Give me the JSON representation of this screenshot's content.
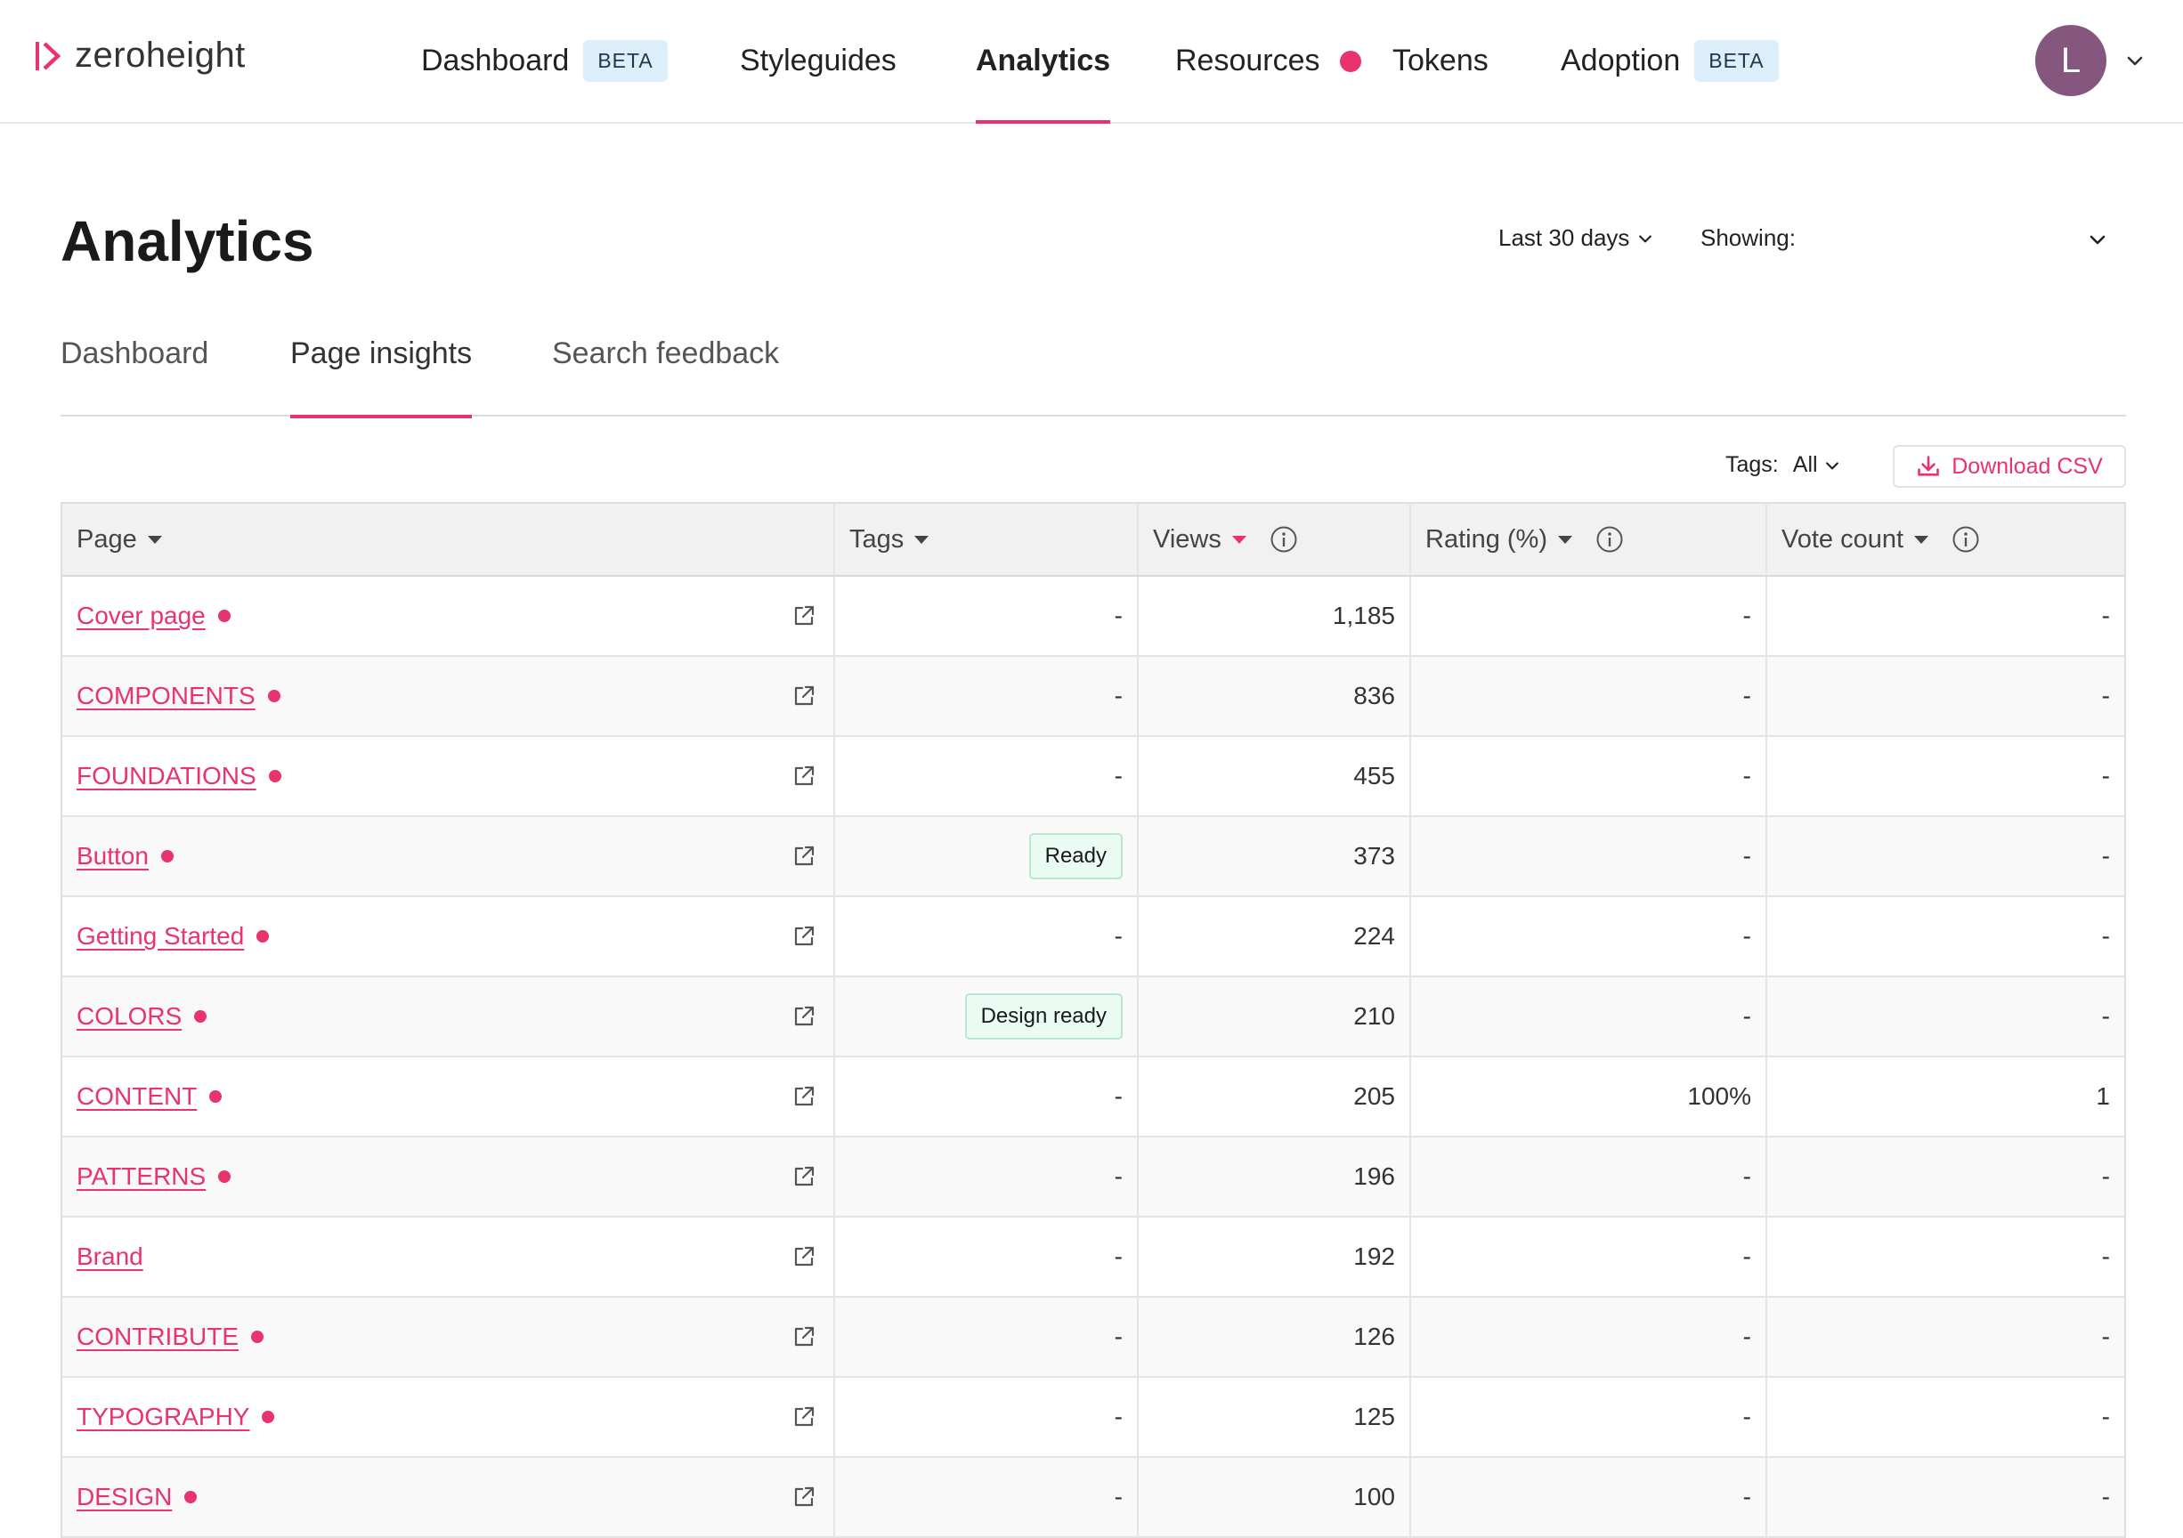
{
  "brand": {
    "name": "zeroheight",
    "accent": "#e8336d"
  },
  "nav": {
    "items": [
      {
        "label": "Dashboard",
        "badge": "BETA"
      },
      {
        "label": "Styleguides"
      },
      {
        "label": "Analytics"
      },
      {
        "label": "Resources"
      },
      {
        "label": "Tokens"
      },
      {
        "label": "Adoption",
        "badge": "BETA"
      }
    ],
    "active": "Analytics"
  },
  "user": {
    "initial": "L"
  },
  "header": {
    "title": "Analytics",
    "range_label": "Last 30 days",
    "showing_label": "Showing:"
  },
  "subtabs": [
    {
      "label": "Dashboard"
    },
    {
      "label": "Page insights"
    },
    {
      "label": "Search feedback"
    }
  ],
  "toolbar": {
    "tags_label": "Tags:",
    "tags_value": "All",
    "download_label": "Download CSV"
  },
  "table": {
    "columns": {
      "page": "Page",
      "tags": "Tags",
      "views": "Views",
      "rating": "Rating (%)",
      "votes": "Vote count"
    },
    "rows": [
      {
        "page": "Cover page",
        "dot": true,
        "tags": "-",
        "tag_pill": false,
        "views": "1,185",
        "rating": "-",
        "votes": "-"
      },
      {
        "page": "COMPONENTS",
        "dot": true,
        "tags": "-",
        "tag_pill": false,
        "views": "836",
        "rating": "-",
        "votes": "-"
      },
      {
        "page": "FOUNDATIONS",
        "dot": true,
        "tags": "-",
        "tag_pill": false,
        "views": "455",
        "rating": "-",
        "votes": "-"
      },
      {
        "page": "Button",
        "dot": true,
        "tags": "Ready",
        "tag_pill": true,
        "views": "373",
        "rating": "-",
        "votes": "-"
      },
      {
        "page": "Getting Started",
        "dot": true,
        "tags": "-",
        "tag_pill": false,
        "views": "224",
        "rating": "-",
        "votes": "-"
      },
      {
        "page": "COLORS",
        "dot": true,
        "tags": "Design ready",
        "tag_pill": true,
        "views": "210",
        "rating": "-",
        "votes": "-"
      },
      {
        "page": "CONTENT",
        "dot": true,
        "tags": "-",
        "tag_pill": false,
        "views": "205",
        "rating": "100%",
        "votes": "1"
      },
      {
        "page": "PATTERNS",
        "dot": true,
        "tags": "-",
        "tag_pill": false,
        "views": "196",
        "rating": "-",
        "votes": "-"
      },
      {
        "page": "Brand",
        "dot": false,
        "tags": "-",
        "tag_pill": false,
        "views": "192",
        "rating": "-",
        "votes": "-"
      },
      {
        "page": "CONTRIBUTE",
        "dot": true,
        "tags": "-",
        "tag_pill": false,
        "views": "126",
        "rating": "-",
        "votes": "-"
      },
      {
        "page": "TYPOGRAPHY",
        "dot": true,
        "tags": "-",
        "tag_pill": false,
        "views": "125",
        "rating": "-",
        "votes": "-"
      },
      {
        "page": "DESIGN",
        "dot": true,
        "tags": "-",
        "tag_pill": false,
        "views": "100",
        "rating": "-",
        "votes": "-"
      }
    ]
  }
}
